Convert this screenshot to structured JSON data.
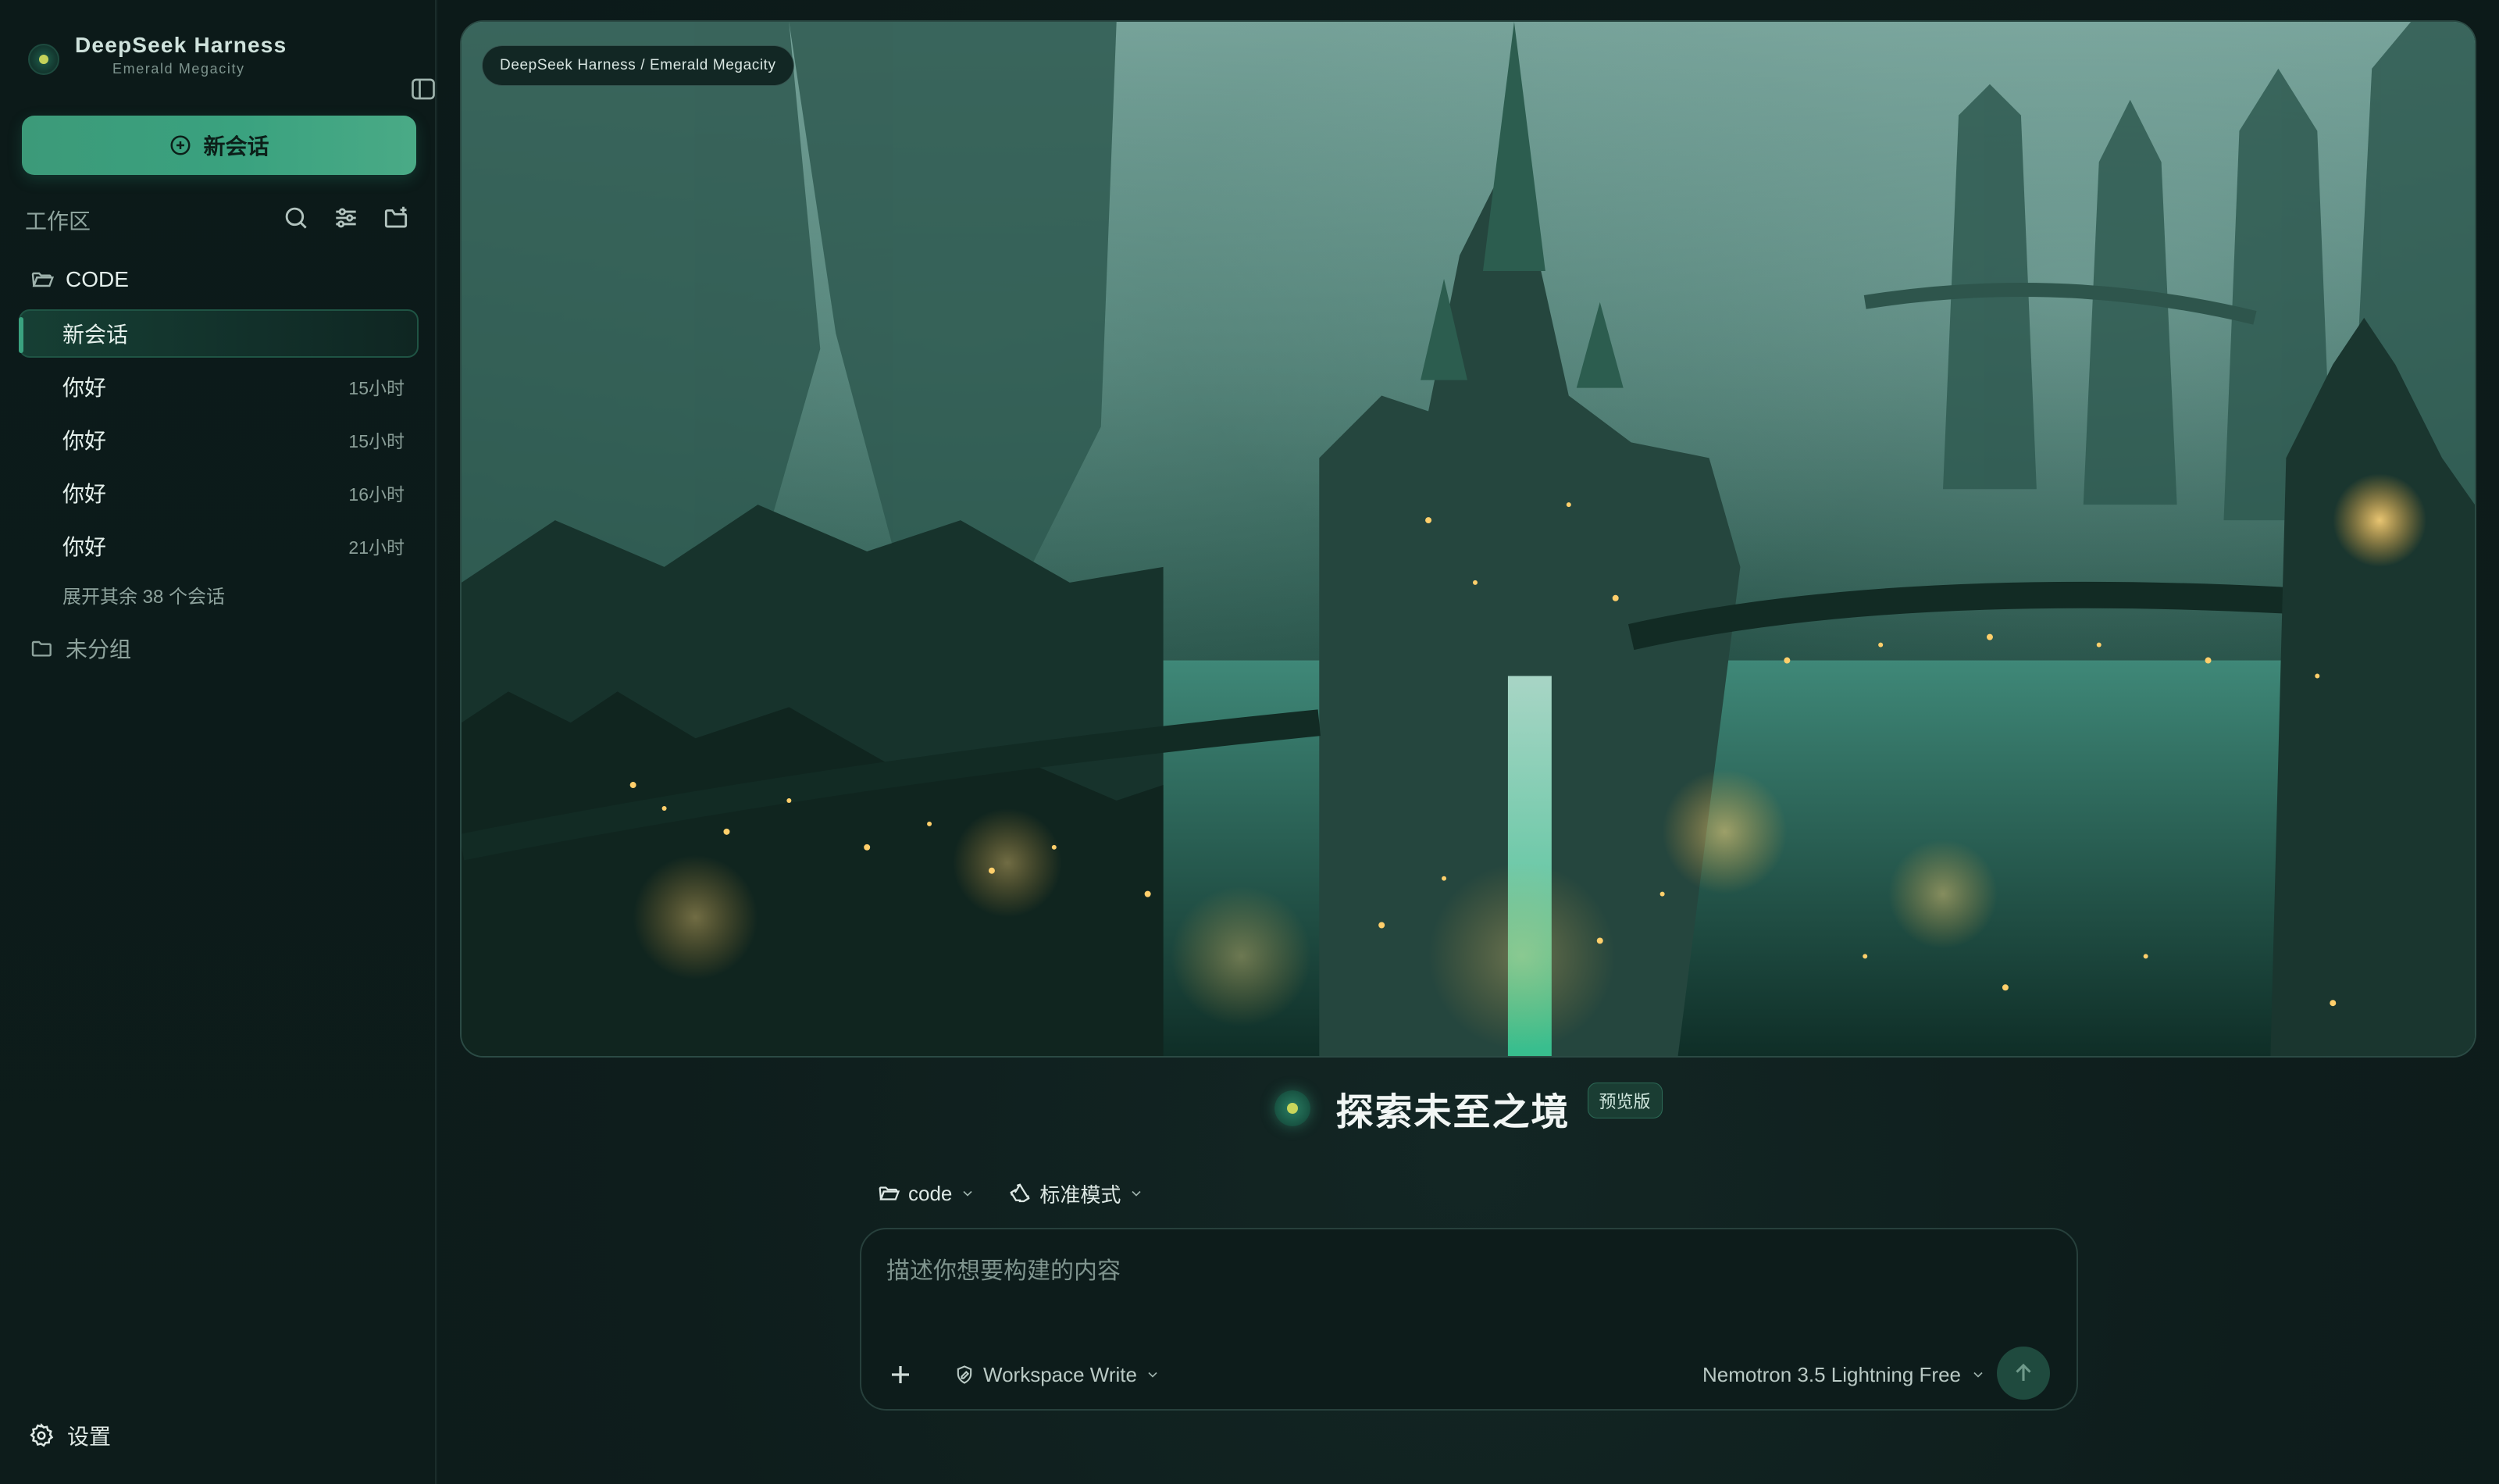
{
  "brand": {
    "title": "DeepSeek Harness",
    "subtitle": "Emerald Megacity"
  },
  "sidebar": {
    "new_chat_label": "新会话",
    "workspace_label": "工作区",
    "folders": [
      {
        "name": "CODE",
        "items": [
          {
            "label": "新会话",
            "time": "",
            "active": true
          },
          {
            "label": "你好",
            "time": "15小时"
          },
          {
            "label": "你好",
            "time": "15小时"
          },
          {
            "label": "你好",
            "time": "16小时"
          },
          {
            "label": "你好",
            "time": "21小时"
          }
        ],
        "expand_more": "展开其余 38 个会话"
      },
      {
        "name": "未分组"
      }
    ],
    "settings_label": "设置"
  },
  "hero": {
    "badge": "DeepSeek Harness / Emerald Megacity"
  },
  "main": {
    "title": "探索未至之境",
    "title_badge": "预览版",
    "folder_selector": "code",
    "mode_selector": "标准模式"
  },
  "composer": {
    "placeholder": "描述你想要构建的内容",
    "value": "",
    "permission": "Workspace Write",
    "model": "Nemotron 3.5 Lightning Free"
  },
  "colors": {
    "accent": "#3aa27f",
    "background": "#0e1d1c",
    "sidebar": "#0c1a19",
    "dot_core": "#c9d65b"
  }
}
